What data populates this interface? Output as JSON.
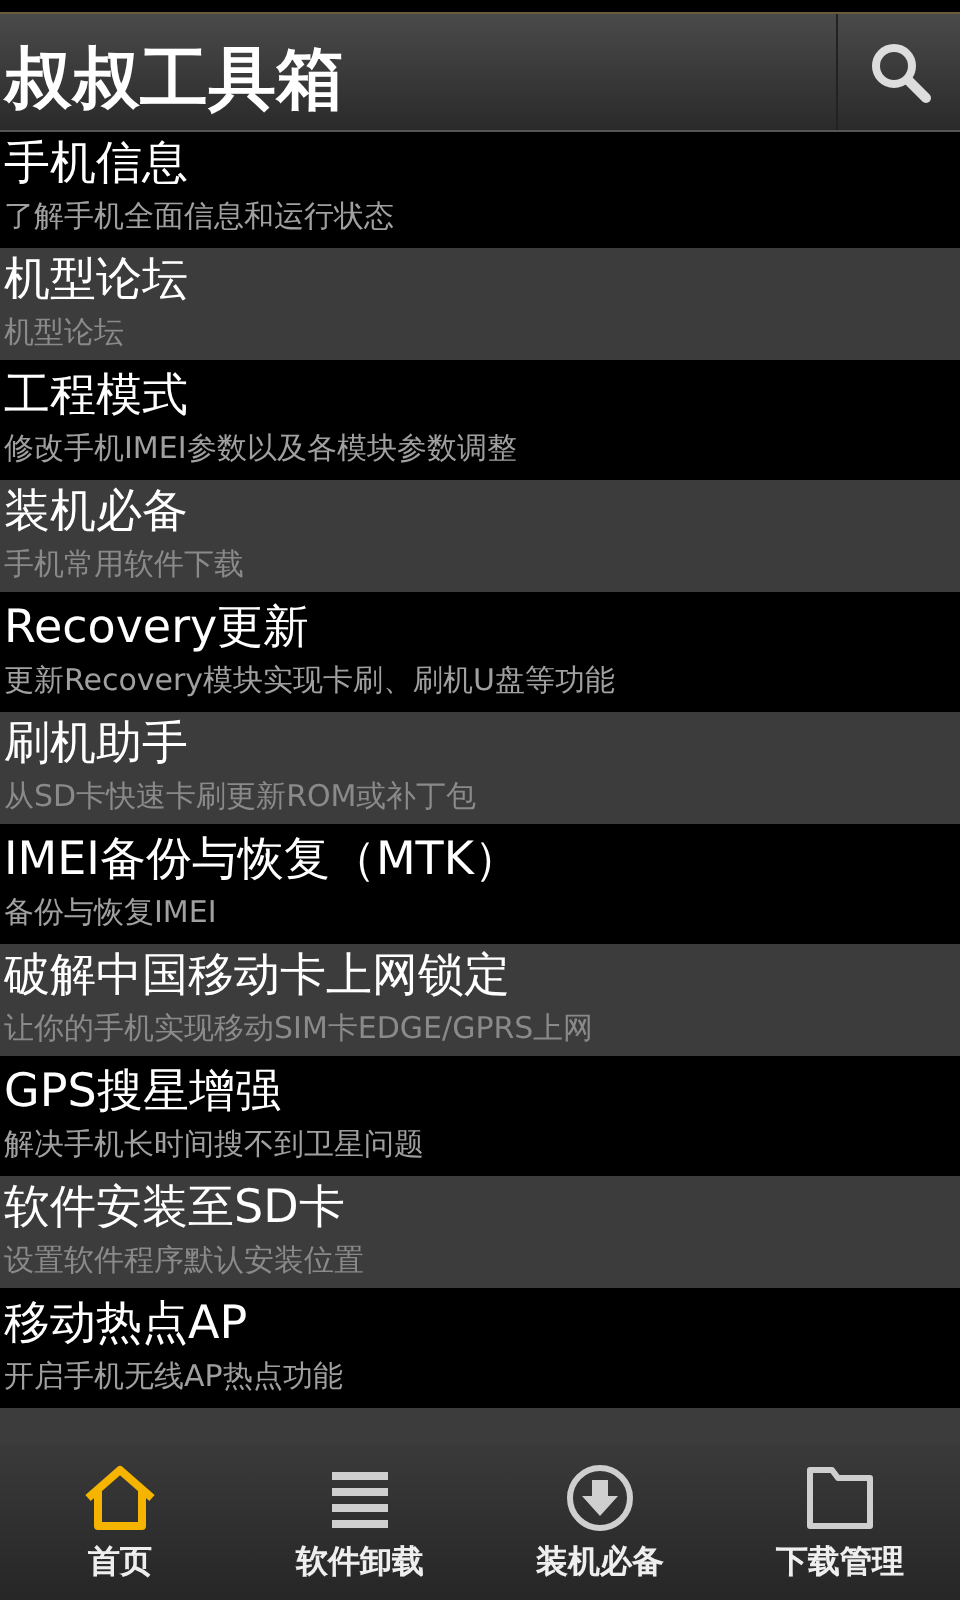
{
  "app_bar": {
    "title": "叔叔工具箱"
  },
  "items": [
    {
      "title": "手机信息",
      "subtitle": "了解手机全面信息和运行状态"
    },
    {
      "title": "机型论坛",
      "subtitle": "机型论坛"
    },
    {
      "title": "工程模式",
      "subtitle": "修改手机IMEI参数以及各模块参数调整"
    },
    {
      "title": "装机必备",
      "subtitle": "手机常用软件下载"
    },
    {
      "title": "Recovery更新",
      "subtitle": "更新Recovery模块实现卡刷、刷机U盘等功能"
    },
    {
      "title": "刷机助手",
      "subtitle": "从SD卡快速卡刷更新ROM或补丁包"
    },
    {
      "title": "IMEI备份与恢复（MTK）",
      "subtitle": "备份与恢复IMEI"
    },
    {
      "title": "破解中国移动卡上网锁定",
      "subtitle": "让你的手机实现移动SIM卡EDGE/GPRS上网"
    },
    {
      "title": "GPS搜星增强",
      "subtitle": "解决手机长时间搜不到卫星问题"
    },
    {
      "title": "软件安装至SD卡",
      "subtitle": "设置软件程序默认安装位置"
    },
    {
      "title": "移动热点AP",
      "subtitle": "开启手机无线AP热点功能"
    }
  ],
  "tabs": [
    {
      "label": "首页",
      "kind": "home",
      "selected": true
    },
    {
      "label": "软件卸载",
      "kind": "list",
      "selected": false
    },
    {
      "label": "装机必备",
      "kind": "download",
      "selected": false
    },
    {
      "label": "下载管理",
      "kind": "folder",
      "selected": false
    }
  ]
}
